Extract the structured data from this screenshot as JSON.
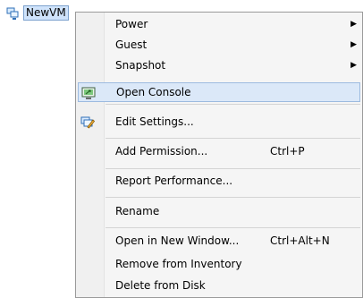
{
  "tree": {
    "vm_name": "NewVM"
  },
  "menu": {
    "power": "Power",
    "guest": "Guest",
    "snapshot": "Snapshot",
    "open_console": "Open Console",
    "edit_settings": "Edit Settings...",
    "add_permission": "Add Permission...",
    "add_permission_shortcut": "Ctrl+P",
    "report_performance": "Report Performance...",
    "rename": "Rename",
    "open_new_window": "Open in New Window...",
    "open_new_window_shortcut": "Ctrl+Alt+N",
    "remove_from_inventory": "Remove from Inventory",
    "delete_from_disk": "Delete from Disk"
  },
  "icons": {
    "vm": "virtual-machine-icon",
    "console": "console-icon",
    "settings": "edit-settings-icon",
    "submenu": "submenu-arrow-icon"
  },
  "colors": {
    "highlight": "#dbe8f8",
    "highlight_border": "#9dbbe0"
  }
}
